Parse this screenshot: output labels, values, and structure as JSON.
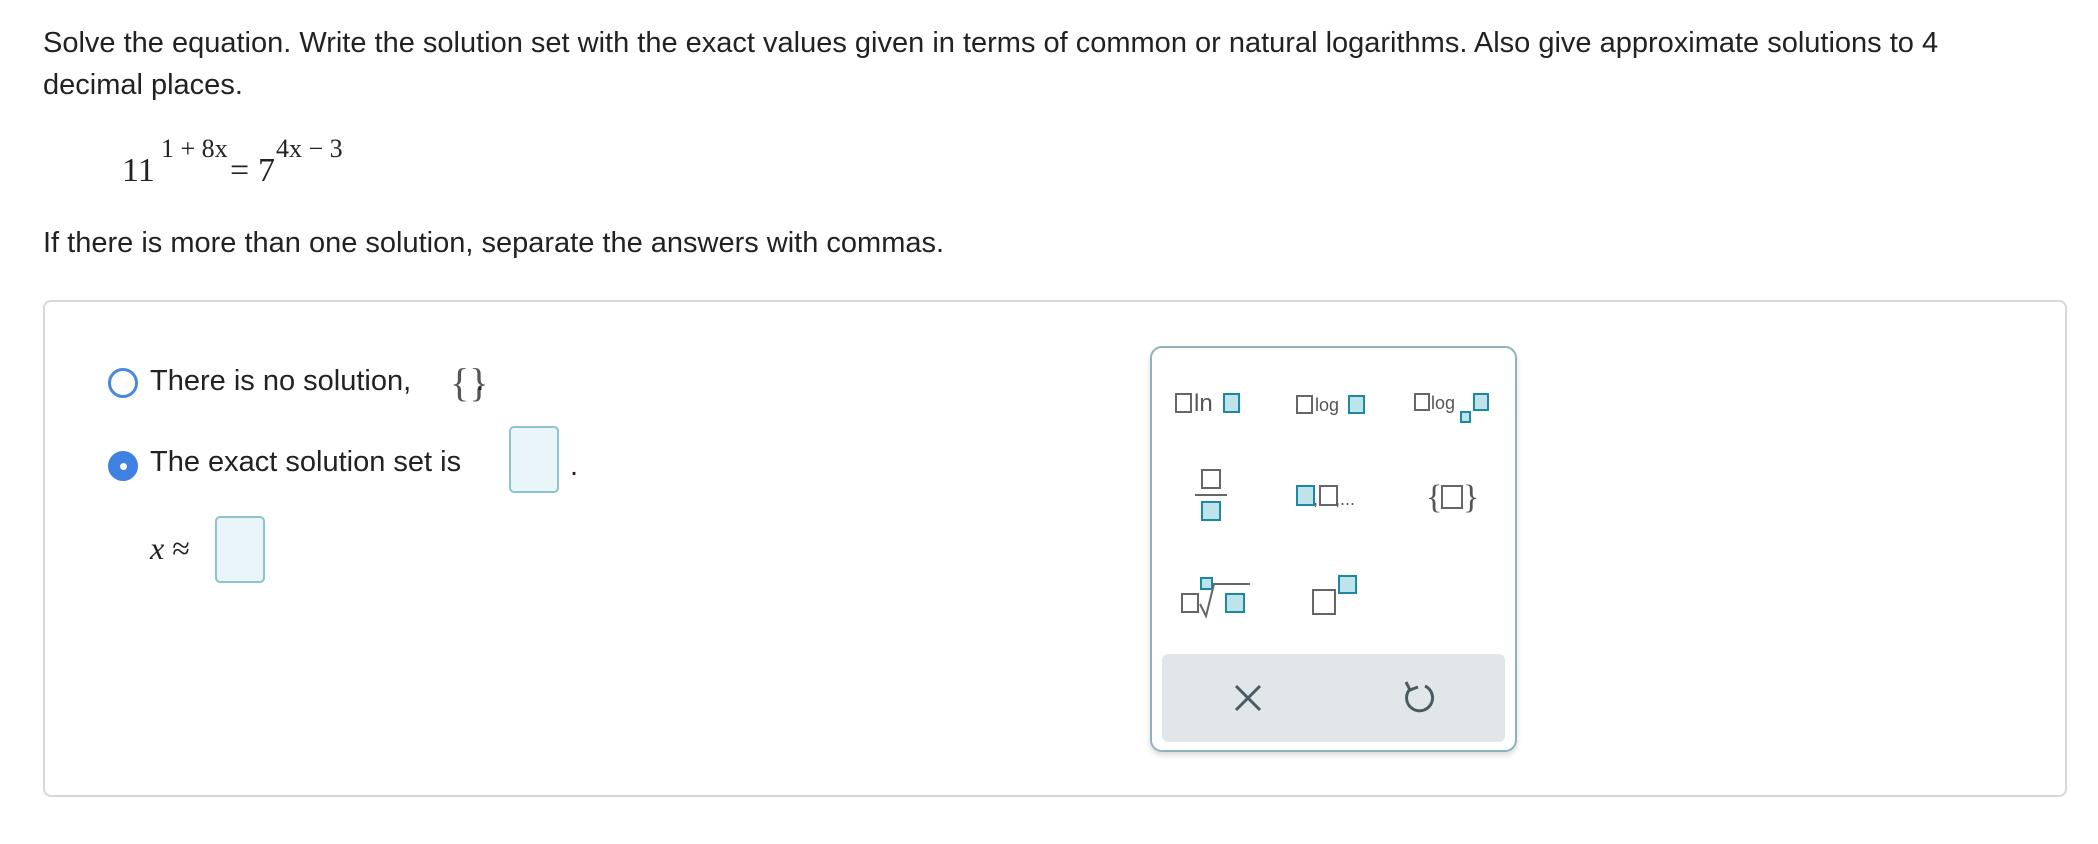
{
  "question": {
    "instructions": "Solve the equation. Write the solution set with the exact values given in terms of common or natural logarithms. Also give approximate solutions to 4 decimal places.",
    "equation": {
      "lhs_base": "11",
      "lhs_exponent": "1 + 8x",
      "equals": "=",
      "rhs_base": "7",
      "rhs_exponent": "4x − 3"
    },
    "separator_note": "If there is more than one solution, separate the answers with commas."
  },
  "answer": {
    "options": [
      {
        "label": "There is no solution,",
        "suffix": "{}",
        "end": ".",
        "selected": false
      },
      {
        "label": "The exact solution set is",
        "end": ".",
        "selected": true
      }
    ],
    "approx_label": {
      "var": "x",
      "symbol": "≈"
    },
    "exact_input_value": "",
    "approx_input_value": ""
  },
  "palette": {
    "buttons": [
      {
        "name": "natural-log-icon",
        "text": "ln"
      },
      {
        "name": "common-log-icon",
        "text": "log"
      },
      {
        "name": "log-base-icon",
        "text": "log"
      },
      {
        "name": "fraction-icon"
      },
      {
        "name": "list-icon",
        "text": ",..."
      },
      {
        "name": "set-braces-icon",
        "text": "{ }"
      },
      {
        "name": "nth-root-icon"
      },
      {
        "name": "exponent-icon"
      }
    ],
    "footer": [
      {
        "name": "clear-icon"
      },
      {
        "name": "undo-icon"
      }
    ]
  },
  "colors": {
    "accent": "#3f80e3",
    "input_border": "#8cc3cf",
    "input_fill": "#e9f5f8",
    "palette_icon": "#1a8aa0"
  }
}
